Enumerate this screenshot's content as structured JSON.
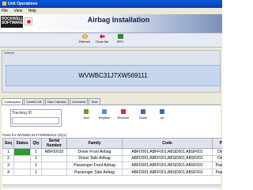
{
  "window": {
    "title": "Unit Operations"
  },
  "menu": {
    "items": [
      "File",
      "View",
      "Help"
    ]
  },
  "brand": {
    "logo_text": "ROCKWELL SOFTWARE"
  },
  "app": {
    "title": "Airbag Installation"
  },
  "toolbar": {
    "buttons": [
      "Refresh",
      "Close file",
      "SPC"
    ]
  },
  "vehicle": {
    "label": "Vehicle",
    "vin": "WVWBC31J7XW569111"
  },
  "tabs": [
    "Consumption",
    "Current Unit",
    "Data Collection",
    "Comments",
    "Tests"
  ],
  "tracking": {
    "label": "Tracking ID",
    "value": ""
  },
  "actions": [
    "Add",
    "Replace",
    "Remove",
    "Down",
    "Up"
  ],
  "parts": {
    "caption": "Parts for WVWBC31J7XW569111 (6)(1)",
    "columns": [
      "Seq",
      "Status",
      "Qty",
      "Serial Number",
      "Family",
      "Code",
      "Po"
    ],
    "rows": [
      {
        "seq": "1",
        "status": "",
        "qty": "1",
        "serial": "ABF00010",
        "family": "Driver Front Airbag",
        "code": "ABFD001;ABFF001;ABSD001;ABSF001",
        "po": "Drive"
      },
      {
        "seq": "2",
        "status": "",
        "qty": "1",
        "serial": "",
        "family": "Driver Side Airbag",
        "code": "ABFD001;ABFF001;ABSD001;ABSF001",
        "po": "Drive"
      },
      {
        "seq": "3",
        "status": "",
        "qty": "1",
        "serial": "",
        "family": "Passenger Front Airbag",
        "code": "ABFD001;ABFF001;ABSD001;ABSF001",
        "po": "Passen"
      },
      {
        "seq": "4",
        "status": "",
        "qty": "1",
        "serial": "",
        "family": "Passenger Side Airbag",
        "code": "ABFD001;ABFF001;ABSD001;ABSF001",
        "po": "Passen"
      }
    ]
  },
  "colors": {
    "status_ok": "#2f9a2f",
    "title_bar": "#0a58d8",
    "vin_panel": "#c6d6ee"
  }
}
